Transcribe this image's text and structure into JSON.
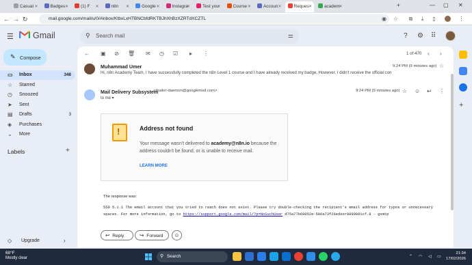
{
  "browser": {
    "tabs": [
      {
        "label": "Casual",
        "color": "#9aa0a6"
      },
      {
        "label": "Badges",
        "color": "#5c6bc0"
      },
      {
        "label": "(1) F",
        "color": "#e53935"
      },
      {
        "label": "n8n",
        "color": "#5c6bc0"
      },
      {
        "label": "Google",
        "color": "#4285f4"
      },
      {
        "label": "Instagra",
        "color": "#d62976"
      },
      {
        "label": "Test you",
        "color": "#e91e63"
      },
      {
        "label": "Course",
        "color": "#e65100"
      },
      {
        "label": "Accoun",
        "color": "#5c6bc0"
      },
      {
        "label": "Reques",
        "color": "#ea4335"
      },
      {
        "label": "academ",
        "color": "#34a853"
      }
    ],
    "url": "mail.google.com/mail/u/0/#inbox/KtbxLxHTBNCbfdRKTBJhXhBzXZRTdXCZTL"
  },
  "gmail": {
    "app_name": "Gmail",
    "search_placeholder": "Search mail"
  },
  "sidebar": {
    "compose_label": "Compose",
    "items": [
      {
        "label": "Inbox",
        "count": "348",
        "icon": "inbox-icon",
        "glyph": "▭"
      },
      {
        "label": "Starred",
        "count": "",
        "icon": "star-icon",
        "glyph": "☆"
      },
      {
        "label": "Snoozed",
        "count": "",
        "icon": "clock-icon",
        "glyph": "◷"
      },
      {
        "label": "Sent",
        "count": "",
        "icon": "send-icon",
        "glyph": "➤"
      },
      {
        "label": "Drafts",
        "count": "3",
        "icon": "draft-icon",
        "glyph": "▤"
      },
      {
        "label": "Purchases",
        "count": "",
        "icon": "tag-icon",
        "glyph": "◈"
      },
      {
        "label": "More",
        "count": "",
        "icon": "chevron-down-icon",
        "glyph": "⌄"
      }
    ],
    "labels_heading": "Labels",
    "upgrade_label": "Upgrade"
  },
  "toolbar": {
    "pager": "1 of 470"
  },
  "thread": {
    "msg1": {
      "sender": "Muhammad Umer",
      "snippet": "Hi, n8n Academy Team, I have successfully completed the n8n Level 1 course and I have already received my badge. However, I didn't receive the official completi",
      "time": "9:24 PM (9 minutes ago)"
    },
    "msg2": {
      "sender": "Mail Delivery Subsystem",
      "email": "<mailer-daemon@googlemail.com>",
      "to": "to me",
      "time": "9:24 PM (9 minutes ago)"
    },
    "bounce": {
      "title": "Address not found",
      "body_pre": "Your message wasn't delivered to ",
      "address": "academy@n8n.io",
      "body_post": " because the address couldn't be found, or is unable to receive mail.",
      "learn_more": "LEARN MORE"
    },
    "response_intro": "The response was:",
    "response_line1": "550 5.1.1 The email account that you tried to reach does not exist. Please try double-checking the recipient's email address for typos or unnecessary",
    "response_line2_pre": "spaces. For more information, go to ",
    "response_link": "https://support.google.com/mail/?p=NoSuchUser",
    "response_line2_post": " d75a77b69052e-506a73f26edsor8090991cf.8 - gsmtp",
    "reply_label": "Reply",
    "forward_label": "Forward"
  },
  "taskbar": {
    "temp": "68°F",
    "weather": "Mostly clear",
    "search_label": "Search",
    "time": "21:34",
    "date": "17/02/2026"
  }
}
